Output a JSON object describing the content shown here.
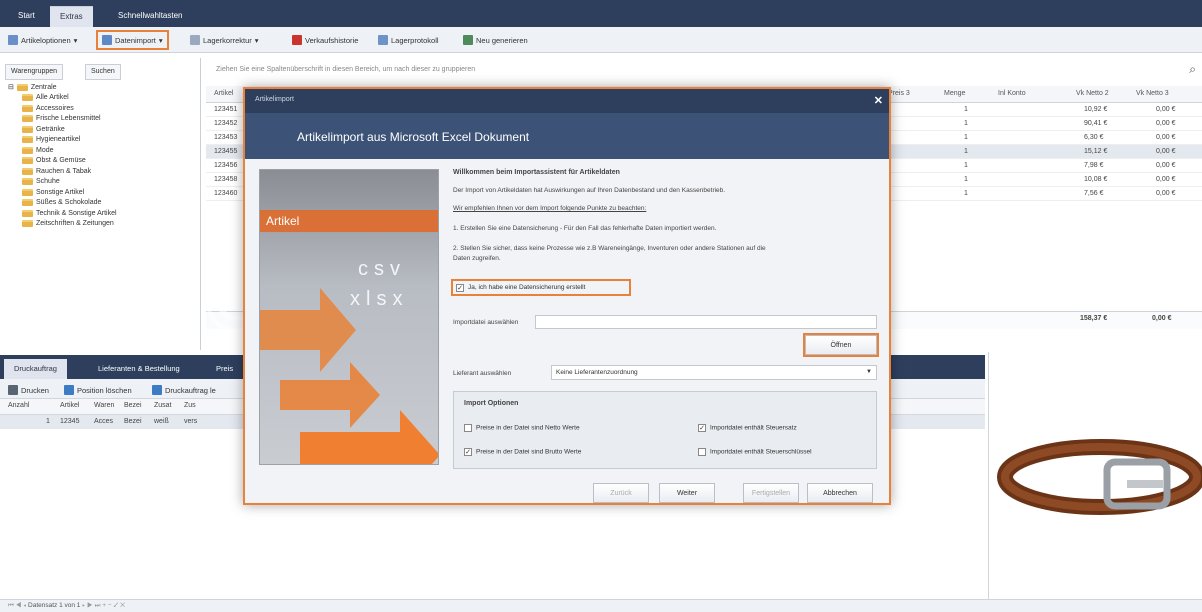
{
  "app": {
    "tabs": [
      "Start",
      "Extras",
      "Schnellwahltasten"
    ]
  },
  "toolbar": {
    "items": [
      "Artikeloptionen",
      "Datenimport",
      "Lagerkorrektur",
      "Verkaufshistorie",
      "Lagerprotokoll",
      "Neu generieren"
    ]
  },
  "left": {
    "tabs": [
      "Warengruppen",
      "Suchen"
    ],
    "tree": [
      "Zentrale",
      "Alle Artikel",
      "Accessoires",
      "Frische Lebensmittel",
      "Getränke",
      "Hygieneartikel",
      "Mode",
      "Obst & Gemüse",
      "Rauchen & Tabak",
      "Schuhe",
      "Sonstige Artikel",
      "Süßes & Schokolade",
      "Technik & Sonstige Artikel",
      "Zeitschriften & Zeitungen"
    ]
  },
  "grid": {
    "group_hint": "Ziehen Sie eine Spaltenüberschrift in diesen Bereich, um nach dieser zu gruppieren",
    "headers": [
      "Artikel",
      "Preis 3",
      "Menge",
      "Inl Konto",
      "Vk Netto 2",
      "Vk Netto 3"
    ],
    "rows": [
      {
        "id": "123451",
        "menge": "1",
        "vk2": "10,92 €",
        "vk3": "0,00 €"
      },
      {
        "id": "123452",
        "menge": "1",
        "vk2": "90,41 €",
        "vk3": "0,00 €"
      },
      {
        "id": "123453",
        "menge": "1",
        "vk2": "6,30 €",
        "vk3": "0,00 €"
      },
      {
        "id": "123455",
        "menge": "1",
        "vk2": "15,12 €",
        "vk3": "0,00 €"
      },
      {
        "id": "123456",
        "menge": "1",
        "vk2": "7,98 €",
        "vk3": "0,00 €"
      },
      {
        "id": "123458",
        "menge": "1",
        "vk2": "10,08 €",
        "vk3": "0,00 €"
      },
      {
        "id": "123460",
        "menge": "1",
        "vk2": "7,56 €",
        "vk3": "0,00 €"
      }
    ],
    "total_vk2": "158,37 €",
    "total_vk3": "0,00 €"
  },
  "bottom": {
    "tabs": [
      "Druckauftrag",
      "Lieferanten & Bestellung",
      "Preis"
    ],
    "tools": [
      "Drucken",
      "Position löschen",
      "Druckauftrag le"
    ],
    "headers": [
      "Anzahl",
      "Artikel",
      "Waren",
      "Bezei",
      "Zusat",
      "Zus"
    ],
    "row": [
      "1",
      "12345",
      "Acces",
      "Bezei",
      "weiß",
      "vers"
    ],
    "status": "Datensatz 1 von 1"
  },
  "watermark": "© Aronto GmbH",
  "dialog": {
    "window_title": "Artikelimport",
    "header": "Artikelimport aus Microsoft Excel Dokument",
    "side_label": "Artikel",
    "side_ext1": "csv",
    "side_ext2": "xlsx",
    "welcome": "Willkommen beim Importassistent für Artikeldaten",
    "line1": "Der Import von Artikeldaten hat Auswirkungen auf Ihren Datenbestand und den Kassenbetrieb.",
    "line2": "Wir empfehlen Ihnen vor dem Import folgende Punkte zu beachten:",
    "line3": "1. Erstellen Sie eine Datensicherung - Für den Fall das fehlerhafte Daten importiert werden.",
    "line4a": "2. Stellen Sie sicher, dass keine Prozesse wie z.B Wareneingänge, Inventuren oder andere Stationen auf die",
    "line4b": "Daten zugreifen.",
    "confirm": "Ja, ich habe eine Datensicherung erstellt",
    "file_label": "Importdatei auswählen",
    "open_btn": "Öffnen",
    "supplier_label": "Lieferant auswählen",
    "supplier_value": "Keine Lieferantenzuordnung",
    "options_title": "Import Optionen",
    "opt1": "Preise in der Datei sind Netto Werte",
    "opt2": "Preise in der Datei sind Brutto Werte",
    "opt3": "Importdatei enthält Steuersatz",
    "opt4": "Importdatei enthält Steuerschlüssel",
    "btn_back": "Zurück",
    "btn_next": "Weiter",
    "btn_finish": "Fertigstellen",
    "btn_cancel": "Abbrechen"
  },
  "colors": {
    "nav": "#2e3f5e",
    "accent": "#e8823a",
    "header": "#3c5276"
  }
}
